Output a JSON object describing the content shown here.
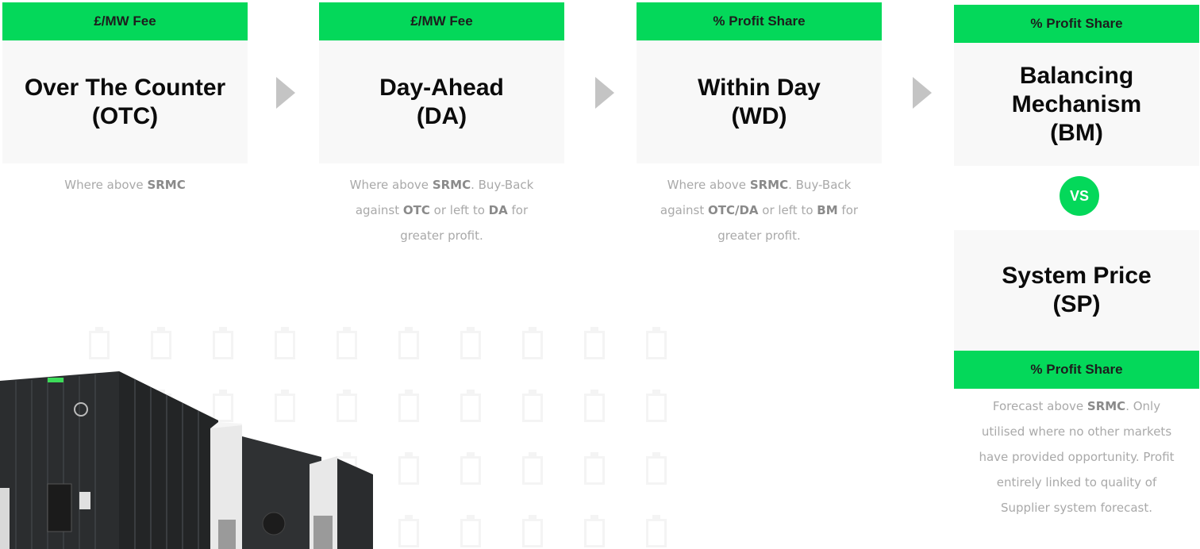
{
  "colors": {
    "accent": "#04d85a",
    "card_bg": "#f8f8f8",
    "arrow": "#c4c4c4",
    "desc_text": "#a9a9a9"
  },
  "columns": [
    {
      "fee": "£/MW Fee",
      "title_line1": "Over The Counter",
      "title_line2": "(OTC)"
    },
    {
      "fee": "£/MW Fee",
      "title_line1": "Day-Ahead",
      "title_line2": "(DA)"
    },
    {
      "fee": "% Profit Share",
      "title_line1": "Within Day",
      "title_line2": "(WD)"
    },
    {
      "fee": "% Profit Share",
      "title_line1": "Balancing",
      "title_line2": "Mechanism",
      "title_line3": "(BM)"
    }
  ],
  "desc_otc": {
    "t1": "Where above ",
    "b1": "SRMC"
  },
  "desc_da": {
    "t1": "Where above ",
    "b1": "SRMC",
    "t2": ". Buy-Back",
    "t3": "against ",
    "b2": "OTC",
    "t4": " or left to ",
    "b3": "DA",
    "t5": " for",
    "t6": "greater profit."
  },
  "desc_wd": {
    "t1": "Where above ",
    "b1": "SRMC",
    "t2": ". Buy-Back",
    "t3": "against ",
    "b2": "OTC/DA",
    "t4": " or left to ",
    "b3": "BM",
    "t5": " for",
    "t6": "greater profit."
  },
  "vs_label": "VS",
  "sp": {
    "title_line1": "System Price",
    "title_line2": "(SP)",
    "fee": "% Profit Share",
    "d_t1": "Forecast above ",
    "d_b1": "SRMC",
    "d_t2": ". Only",
    "d_t3": "utilised where no other markets",
    "d_t4": "have provided opportunity. Profit",
    "d_t5": "entirely linked to quality of",
    "d_t6": "Supplier system forecast."
  },
  "icons": {
    "arrow": "chevron-right-icon",
    "pattern": "battery-icon"
  },
  "image": {
    "alt": "battery storage container photo"
  }
}
